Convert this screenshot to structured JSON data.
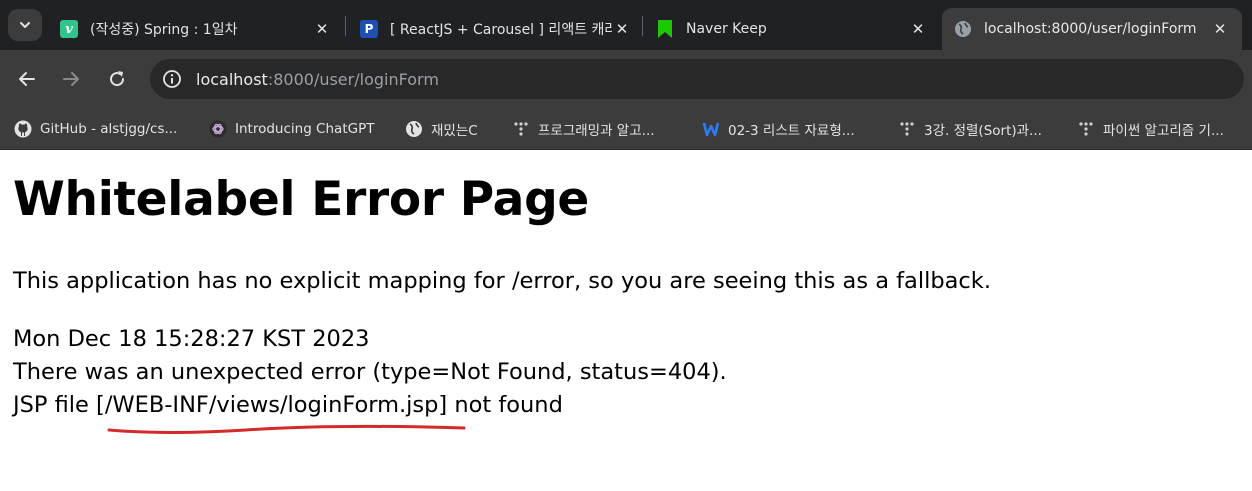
{
  "browser": {
    "tabs": [
      {
        "title": "(작성중) Spring : 1일차",
        "favicon": "vlog-v-icon",
        "active": false
      },
      {
        "title": "[ ReactJS + Carousel ] 리액트 캐러셀",
        "favicon": "p-circle-icon",
        "active": false
      },
      {
        "title": "Naver Keep",
        "favicon": "naver-keep-bookmark-icon",
        "active": false
      },
      {
        "title": "localhost:8000/user/loginForm",
        "favicon": "globe-icon",
        "active": true
      }
    ],
    "address_bar": {
      "host": "localhost",
      "path": ":8000/user/loginForm"
    },
    "bookmarks": [
      {
        "label": "GitHub - alstjgg/cs...",
        "icon": "github-icon"
      },
      {
        "label": "Introducing ChatGPT",
        "icon": "openai-icon"
      },
      {
        "label": "재밌는C",
        "icon": "globe-icon"
      },
      {
        "label": "프로그래밍과 알고...",
        "icon": "tistory-dots-icon"
      },
      {
        "label": "02-3 리스트 자료형...",
        "icon": "wikidocs-w-icon"
      },
      {
        "label": "3강. 정렬(Sort)과...",
        "icon": "tistory-dots-icon"
      },
      {
        "label": "파이썬 알고리즘 기...",
        "icon": "tistory-dots-icon"
      }
    ]
  },
  "page": {
    "heading": "Whitelabel Error Page",
    "explanation": "This application has no explicit mapping for /error, so you are seeing this as a fallback.",
    "timestamp": "Mon Dec 18 15:28:27 KST 2023",
    "error_line": "There was an unexpected error (type=Not Found, status=404).",
    "jsp_line": "JSP file [/WEB-INF/views/loginForm.jsp] not found"
  },
  "colors": {
    "tabstrip_bg": "#202124",
    "toolbar_bg": "#3c3c3c",
    "annotation_underline": "#d42a2a"
  }
}
